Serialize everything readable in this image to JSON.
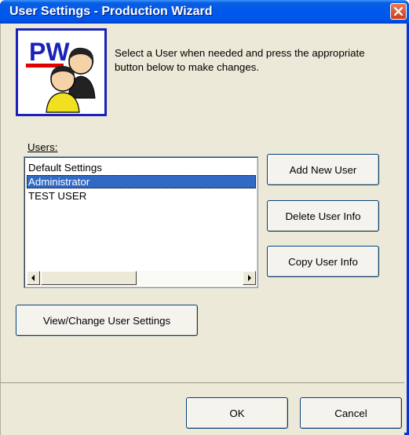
{
  "window": {
    "title": "User Settings - Production Wizard",
    "title_bar_color": "#0058ee"
  },
  "logo": {
    "letters": "PW"
  },
  "intro_text": "Select a User when needed and press the appropriate button below to make changes.",
  "users": {
    "label": "Users:",
    "items": [
      {
        "label": "Default Settings",
        "selected": false
      },
      {
        "label": "Administrator",
        "selected": true
      },
      {
        "label": "TEST USER",
        "selected": false
      }
    ]
  },
  "buttons": {
    "add_new_user": "Add New User",
    "delete_user_info": "Delete User Info",
    "copy_user_info": "Copy User Info",
    "view_change_settings": "View/Change User Settings",
    "ok": "OK",
    "cancel": "Cancel"
  },
  "colors": {
    "selection": "#316ac5",
    "window_border": "#0831d9",
    "face": "#ece9d8"
  }
}
